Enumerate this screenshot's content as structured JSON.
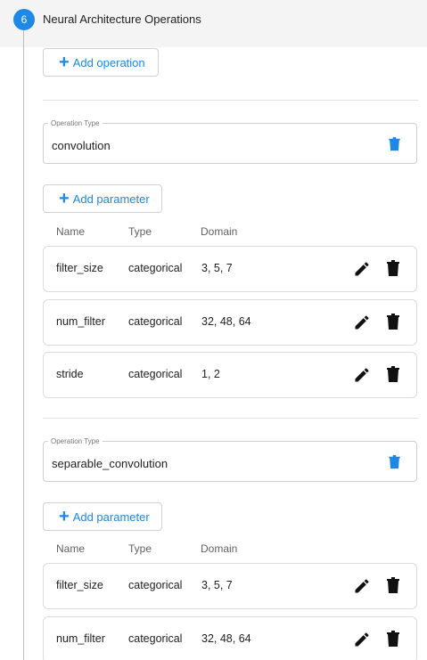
{
  "step": {
    "number": "6",
    "title": "Neural Architecture Operations"
  },
  "add_operation_label": "Add operation",
  "columns": {
    "name": "Name",
    "type": "Type",
    "domain": "Domain"
  },
  "operations": [
    {
      "legend": "Operation Type",
      "value": "convolution",
      "add_parameter_label": "Add parameter",
      "parameters": [
        {
          "name": "filter_size",
          "type": "categorical",
          "domain": "3, 5, 7"
        },
        {
          "name": "num_filter",
          "type": "categorical",
          "domain": "32, 48, 64"
        },
        {
          "name": "stride",
          "type": "categorical",
          "domain": "1, 2"
        }
      ]
    },
    {
      "legend": "Operation Type",
      "value": "separable_convolution",
      "add_parameter_label": "Add parameter",
      "parameters": [
        {
          "name": "filter_size",
          "type": "categorical",
          "domain": "3, 5, 7"
        },
        {
          "name": "num_filter",
          "type": "categorical",
          "domain": "32, 48, 64"
        }
      ]
    }
  ],
  "colors": {
    "accent": "#1e88e5",
    "header_bg": "#f4f4f4",
    "icon_dark": "#111111"
  },
  "icons": {
    "add": "plus-icon",
    "delete_operation": "trash-icon",
    "edit": "pencil-icon",
    "delete_parameter": "trash-icon"
  }
}
